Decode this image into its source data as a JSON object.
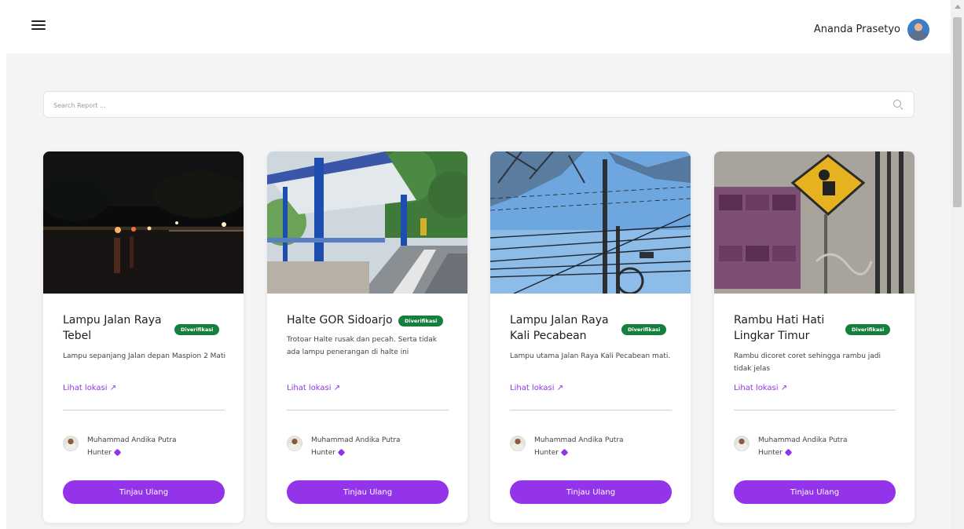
{
  "header": {
    "user_name": "Ananda Prasetyo",
    "menu_icon": "hamburger-icon",
    "avatar_icon": "user-avatar"
  },
  "search": {
    "placeholder": "Search Report ...",
    "value": "",
    "icon": "search-icon"
  },
  "theme": {
    "accent": "#9333ea",
    "badge": "#15803d",
    "background": "#f4f4f5"
  },
  "cards": [
    {
      "title": "Lampu Jalan Raya Tebel",
      "badge": "Diverifikasi",
      "description": "Lampu sepanjang Jalan depan Maspion 2 Mati",
      "location_link": "Lihat lokasi ↗",
      "reporter_name": "Muhammad Andika Putra",
      "reporter_rank": "Hunter",
      "button": "Tinjau Ulang"
    },
    {
      "title": "Halte GOR Sidoarjo",
      "badge": "Diverifikasi",
      "description": "Trotoar Halte rusak dan pecah. Serta tidak ada lampu penerangan di halte ini",
      "location_link": "Lihat lokasi ↗",
      "reporter_name": "Muhammad Andika Putra",
      "reporter_rank": "Hunter",
      "button": "Tinjau Ulang"
    },
    {
      "title": "Lampu Jalan Raya Kali Pecabean",
      "badge": "Diverifikasi",
      "description": "Lampu utama Jalan Raya Kali Pecabean mati.",
      "location_link": "Lihat lokasi ↗",
      "reporter_name": "Muhammad Andika Putra",
      "reporter_rank": "Hunter",
      "button": "Tinjau Ulang"
    },
    {
      "title": "Rambu Hati Hati Lingkar Timur",
      "badge": "Diverifikasi",
      "description": "Rambu dicoret coret sehingga rambu jadi tidak jelas",
      "location_link": "Lihat lokasi ↗",
      "reporter_name": "Muhammad Andika Putra",
      "reporter_rank": "Hunter",
      "button": "Tinjau Ulang"
    }
  ]
}
